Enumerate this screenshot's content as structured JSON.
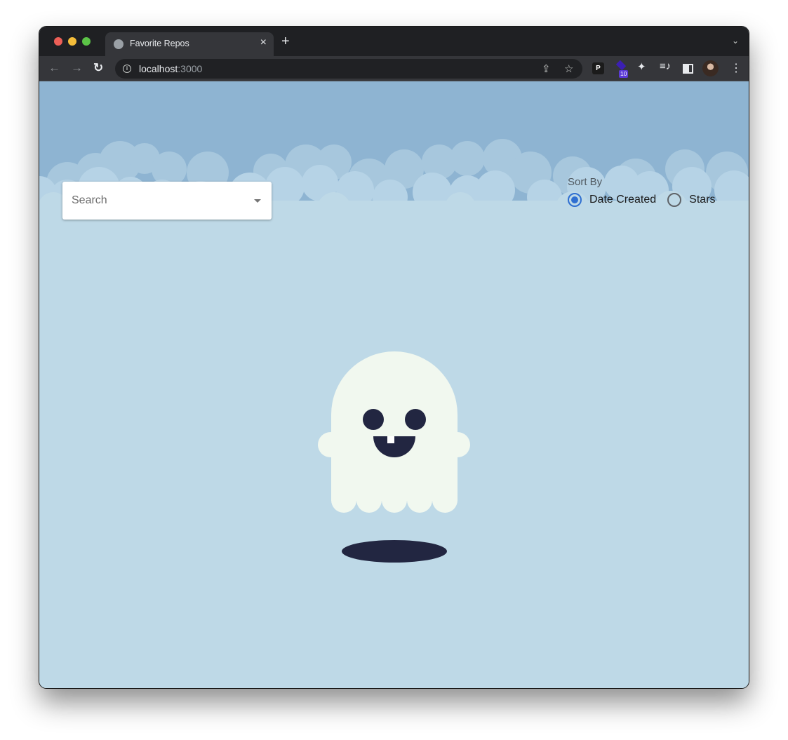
{
  "browser": {
    "tab": {
      "title": "Favorite Repos",
      "favicon": "globe-icon"
    },
    "new_tab_label": "+",
    "tab_close_label": "×",
    "tab_menu_label": "⌄",
    "nav": {
      "back_icon": "←",
      "forward_icon": "→",
      "reload_icon": "↻"
    },
    "address": {
      "host": "localhost",
      "port": ":3000",
      "info_icon": "i"
    },
    "extensions": {
      "p_label": "P",
      "badge_count": "10",
      "kebab_icon": "⋮"
    },
    "omnibox_icons": {
      "share": "⇪",
      "star": "☆"
    },
    "puzzle_icon": "✦",
    "media_icon": "≡♪"
  },
  "page": {
    "search": {
      "placeholder": "Search",
      "value": ""
    },
    "sort": {
      "label": "Sort By",
      "options": [
        {
          "label": "Date Created",
          "checked": true
        },
        {
          "label": "Stars",
          "checked": false
        }
      ]
    },
    "colors": {
      "sky": "#8eb4d2",
      "background": "#bed9e7",
      "ghost_body": "#f1f8ef",
      "ghost_features": "#222641",
      "radio_accent": "#2f6fd1"
    }
  }
}
